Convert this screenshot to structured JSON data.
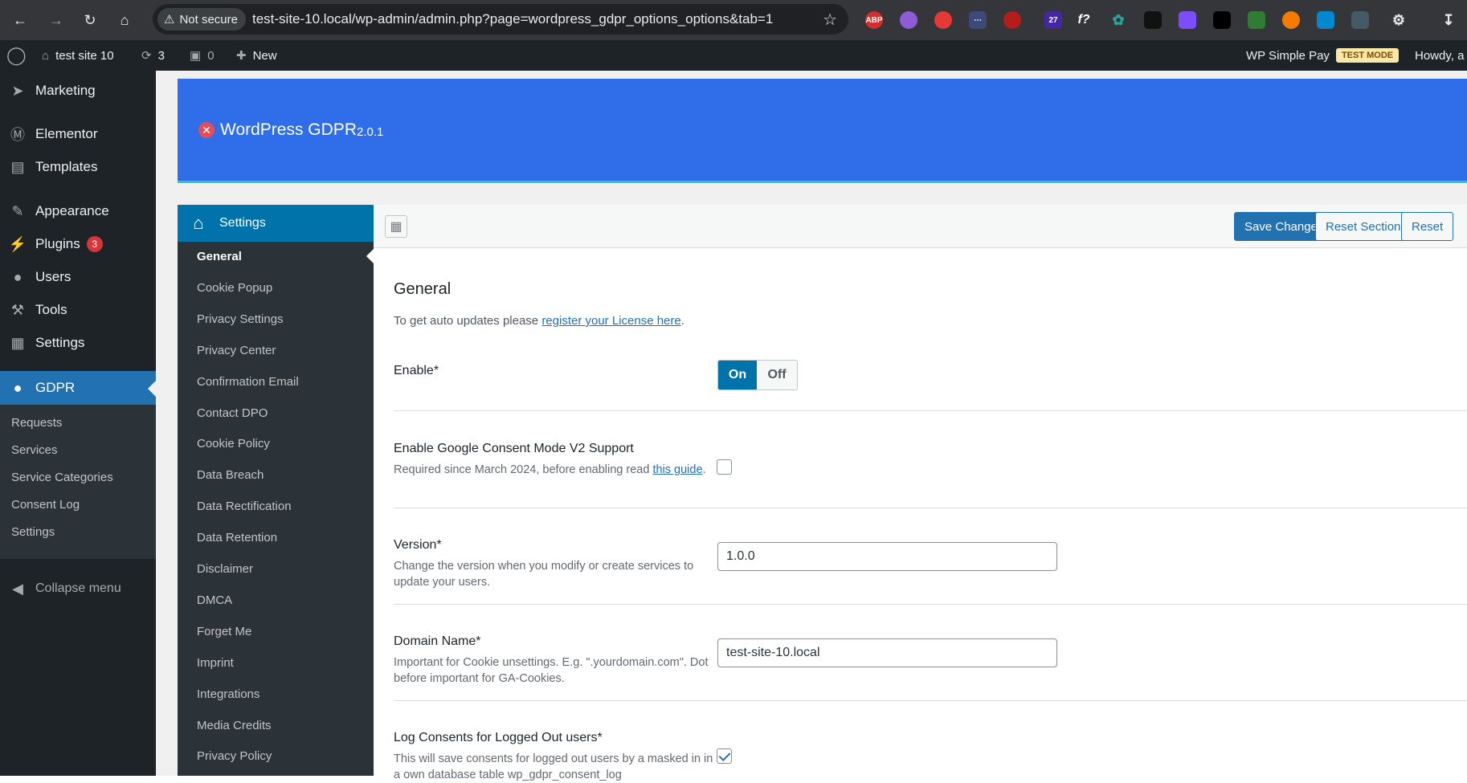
{
  "browser": {
    "security_label": "Not secure",
    "url": "test-site-10.local/wp-admin/admin.php?page=wordpress_gdpr_options_options&tab=1",
    "ext_badge": "27",
    "ext_abp": "ABP",
    "ext_f": "f?"
  },
  "adminbar": {
    "site_name": "test site 10",
    "updates_count": "3",
    "comments_count": "0",
    "new_label": "New",
    "simple_pay_label": "WP Simple Pay",
    "test_mode_label": "TEST MODE",
    "howdy_label": "Howdy, a"
  },
  "wpmenu": {
    "items": [
      {
        "label": "Marketing"
      },
      {
        "label": "Elementor"
      },
      {
        "label": "Templates"
      },
      {
        "label": "Appearance"
      },
      {
        "label": "Plugins",
        "badge": "3"
      },
      {
        "label": "Users"
      },
      {
        "label": "Tools"
      },
      {
        "label": "Settings"
      },
      {
        "label": "GDPR"
      }
    ],
    "submenu": [
      "Requests",
      "Services",
      "Service Categories",
      "Consent Log",
      "Settings"
    ],
    "collapse_label": "Collapse menu"
  },
  "plugin": {
    "title": "WordPress GDPR",
    "version": "2.0.1"
  },
  "optnav": {
    "header": "Settings",
    "items": [
      "General",
      "Cookie Popup",
      "Privacy Settings",
      "Privacy Center",
      "Confirmation Email",
      "Contact DPO",
      "Cookie Policy",
      "Data Breach",
      "Data Rectification",
      "Data Retention",
      "Disclaimer",
      "DMCA",
      "Forget Me",
      "Imprint",
      "Integrations",
      "Media Credits",
      "Privacy Policy"
    ]
  },
  "toolbar": {
    "save_label": "Save Changes",
    "reset_section_label": "Reset Section",
    "reset_all_label": "Reset"
  },
  "section": {
    "title": "General",
    "license_prefix": "To get auto updates please ",
    "license_link": "register your License here",
    "license_suffix": "."
  },
  "fields": {
    "enable": {
      "label": "Enable*",
      "on": "On",
      "off": "Off",
      "value": "On"
    },
    "consent_mode": {
      "label": "Enable Google Consent Mode V2 Support",
      "desc": "Required since March 2024, before enabling read ",
      "link": "this guide",
      "desc_suffix": ".",
      "checked": false
    },
    "version": {
      "label": "Version*",
      "desc": "Change the version when you modify or create services to update your users.",
      "value": "1.0.0"
    },
    "domain": {
      "label": "Domain Name*",
      "desc": "Important for Cookie unsettings. E.g. \".yourdomain.com\". Dot before important for GA-Cookies.",
      "value": "test-site-10.local"
    },
    "log_consents": {
      "label": "Log Consents for Logged Out users*",
      "desc": "This will save consents for logged out users by a masked in in a own database table wp_gdpr_consent_log",
      "checked": true
    }
  }
}
